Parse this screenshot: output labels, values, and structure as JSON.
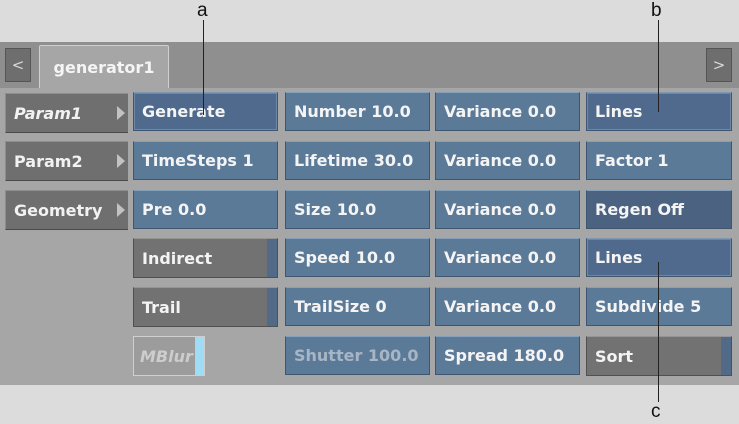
{
  "callouts": {
    "a": "a",
    "b": "b",
    "c": "c"
  },
  "nav": {
    "prev": "<",
    "next": ">"
  },
  "tab": {
    "label": "generator1"
  },
  "side_menu": [
    "Param1",
    "Param2",
    "Geometry"
  ],
  "col1": {
    "generate": "Generate",
    "timesteps": "TimeSteps 1",
    "pre": "Pre 0.0",
    "indirect": "Indirect",
    "trail": "Trail",
    "mblur": "MBlur"
  },
  "col2": [
    "Number 10.0",
    "Lifetime 30.0",
    "Size 10.0",
    "Speed 10.0",
    "TrailSize 0",
    "Shutter 100.0"
  ],
  "col3": [
    "Variance 0.0",
    "Variance 0.0",
    "Variance 0.0",
    "Variance 0.0",
    "Variance 0.0",
    "Spread 180.0"
  ],
  "col4": [
    "Lines",
    "Factor 1",
    "Regen Off",
    "Lines",
    "Subdivide 5",
    "Sort"
  ]
}
